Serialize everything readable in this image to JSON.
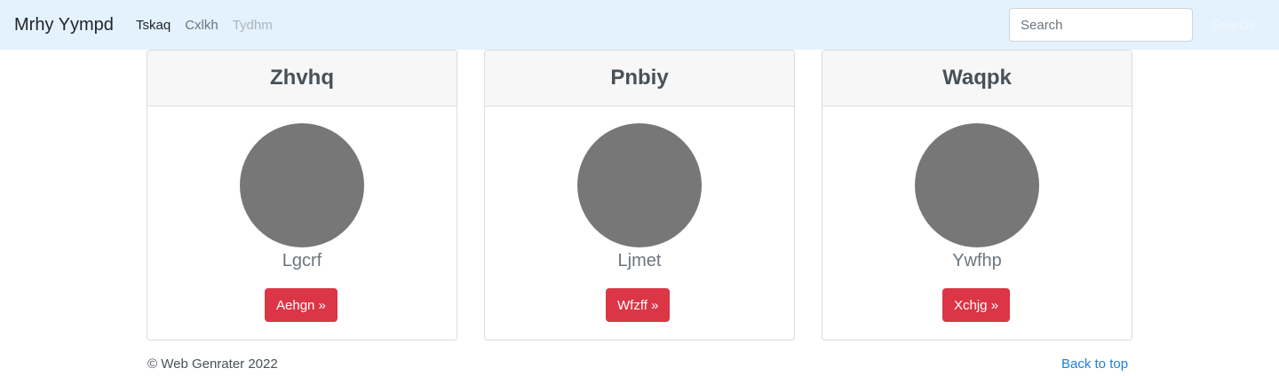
{
  "navbar": {
    "brand": "Mrhy Yympd",
    "links": [
      {
        "label": "Tskaq",
        "state": "active"
      },
      {
        "label": "Cxlkh",
        "state": "normal"
      },
      {
        "label": "Tydhm",
        "state": "disabled"
      }
    ],
    "search": {
      "placeholder": "Search",
      "button_label": "Search"
    }
  },
  "cards": [
    {
      "title": "Zhvhq",
      "name": "Lgcrf",
      "button_label": "Aehgn »"
    },
    {
      "title": "Pnbiy",
      "name": "Ljmet",
      "button_label": "Wfzff »"
    },
    {
      "title": "Waqpk",
      "name": "Ywfhp",
      "button_label": "Xchjg »"
    }
  ],
  "footer": {
    "copyright": "© Web Genrater 2022",
    "back_to_top": "Back to top"
  },
  "colors": {
    "navbar_bg": "#e3f2fd",
    "button_danger": "#dc3545",
    "avatar_placeholder": "#777777",
    "link": "#1e7fd6"
  }
}
